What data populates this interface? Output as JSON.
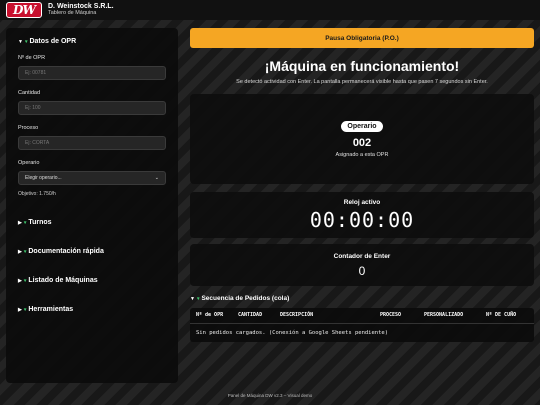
{
  "header": {
    "logo_text": "DW",
    "company": "D. Weinstock S.R.L.",
    "subtitle": "Tablero de Máquina"
  },
  "sidebar": {
    "datos_title": "Datos de OPR",
    "opr_label": "Nº de OPR",
    "opr_placeholder": "Ej: 00781",
    "cantidad_label": "Cantidad",
    "cantidad_placeholder": "Ej: 100",
    "proceso_label": "Proceso",
    "proceso_placeholder": "Ej: CORTA",
    "operario_label": "Operario",
    "operario_select": "Elegir operario...",
    "objetivo": "Objetivo: 1.750/h",
    "sections": [
      "Turnos",
      "Documentación rápida",
      "Listado de Máquinas",
      "Herramientas"
    ]
  },
  "main": {
    "pause_label": "Pausa Obligatoria (P.O.)",
    "headline": "¡Máquina en funcionamiento!",
    "subline": "Se detectó actividad con Enter. La pantalla permanecerá visible hasta que pasen 7 segundos sin Enter.",
    "operario": {
      "badge": "Operario",
      "number": "002",
      "caption": "Asignado a esta OPR"
    },
    "clock": {
      "title": "Reloj activo",
      "value": "00:00:00"
    },
    "counter": {
      "title": "Contador de Enter",
      "value": "0"
    },
    "queue": {
      "title": "Secuencia de Pedidos (cola)",
      "columns": [
        "Nº de OPR",
        "CANTIDAD",
        "DESCRIPCIÓN",
        "PROCESO",
        "PERSONALIZADO",
        "Nº DE CUÑO"
      ],
      "empty_message": "Sin pedidos cargados. (Conexión a Google Sheets pendiente)"
    }
  },
  "footer": "Panel de Máquina DW v2.3 – Visual demo",
  "colors": {
    "accent_orange": "#f5a623",
    "logo_red": "#c8102e",
    "caret_green": "#3ec46d"
  }
}
